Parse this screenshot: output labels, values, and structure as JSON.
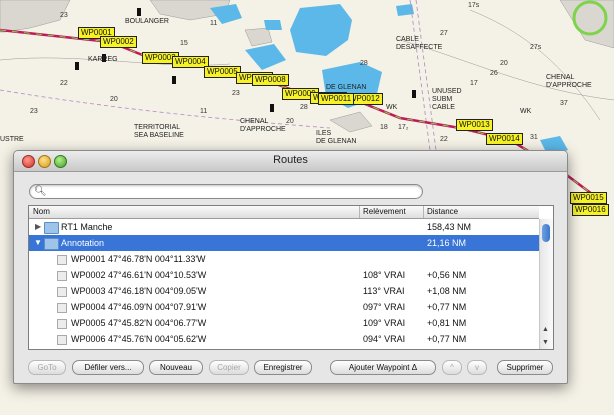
{
  "map": {
    "labels": [
      "BOULANGER",
      "KARREG",
      "TERRITORIAL\nSEA BASELINE",
      "CHENAL\nD'APPROCHE",
      "ILES\nDE GLENAN",
      "DE GLENAN",
      "UNUSED\nSUBM\nCABLE",
      "CABLE\nDESAFFECTE",
      "CHENAL\nD'APPROCHE",
      "USTRE",
      "WK",
      "WK"
    ],
    "depths": [
      "27s",
      "22",
      "17s",
      "17",
      "23",
      "31",
      "18",
      "27",
      "20",
      "15",
      "22",
      "11",
      "37",
      "20",
      "20",
      "17₂",
      "28",
      "26",
      "11",
      "23",
      "28",
      "23"
    ],
    "waypoints": [
      "WP0001",
      "WP0002",
      "WP0003",
      "WP0004",
      "WP0005",
      "WP0007",
      "WP0008",
      "WP0009",
      "WP0010",
      "WP0012",
      "WP0011",
      "WP0013",
      "WP0014",
      "WP0015",
      "WP0016"
    ]
  },
  "window": {
    "title": "Routes",
    "search_placeholder": "",
    "columns": [
      "Nom",
      "Relèvement",
      "Distance"
    ],
    "rows": [
      {
        "name": "RT1 Manche",
        "bearing": "",
        "distance": "158,43 NM"
      },
      {
        "name": "Annotation",
        "bearing": "",
        "distance": "21,16 NM"
      },
      {
        "name": "WP0001 47°46.78'N 004°11.33'W",
        "bearing": "",
        "distance": ""
      },
      {
        "name": "WP0002 47°46.61'N 004°10.53'W",
        "bearing": "108° VRAI",
        "distance": "+0,56 NM"
      },
      {
        "name": "WP0003 47°46.18'N 004°09.05'W",
        "bearing": "113° VRAI",
        "distance": "+1,08 NM"
      },
      {
        "name": "WP0004 47°46.09'N 004°07.91'W",
        "bearing": "097° VRAI",
        "distance": "+0,77 NM"
      },
      {
        "name": "WP0005 47°45.82'N 004°06.77'W",
        "bearing": "109° VRAI",
        "distance": "+0,81 NM"
      },
      {
        "name": "WP0006 47°45.76'N 004°05.62'W",
        "bearing": "094° VRAI",
        "distance": "+0,77 NM"
      }
    ],
    "buttons": {
      "goto": "GoTo",
      "defiler": "Défiler vers...",
      "nouveau": "Nouveau",
      "copier": "Copier",
      "enregistrer": "Enregistrer",
      "ajouter": "Ajouter Waypoint Δ",
      "up": "^",
      "down": "v",
      "supprimer": "Supprimer"
    }
  },
  "colors": {
    "selection": "#3875d7",
    "waypoint_label": "#f6f225",
    "route_line": "#c2185b",
    "shallow_water": "#5bb8e8",
    "land": "#d9d7cf"
  }
}
